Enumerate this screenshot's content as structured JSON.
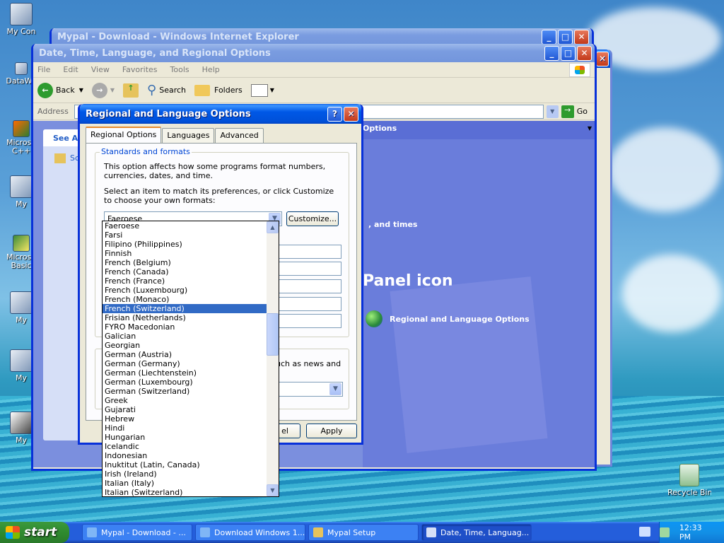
{
  "desktop": {
    "icons": [
      {
        "label": "My Con",
        "name": "my-computer-icon"
      },
      {
        "label": "DataWa",
        "name": "datawa-icon"
      },
      {
        "label": "Microso C++",
        "name": "microsoft-cpp-icon"
      },
      {
        "label": "My",
        "name": "my-doc-icon-1"
      },
      {
        "label": "Microso Basic",
        "name": "microsoft-basic-icon"
      },
      {
        "label": "My",
        "name": "my-doc-icon-2"
      },
      {
        "label": "My",
        "name": "my-doc-icon-3"
      },
      {
        "label": "My",
        "name": "my-doc-icon-4"
      }
    ],
    "recycle_bin": "Recycle Bin"
  },
  "ie_window": {
    "title": "Mypal - Download - Windows Internet Explorer"
  },
  "cp_window": {
    "title": "Date, Time, Language, and Regional Options",
    "menu": [
      "File",
      "Edit",
      "View",
      "Favorites",
      "Tools",
      "Help"
    ],
    "toolbar": {
      "back": "Back",
      "search": "Search",
      "folders": "Folders"
    },
    "address_label": "Address",
    "go": "Go",
    "see_also": "See Als",
    "sched": "Sch",
    "options_link": "Options",
    "times_link": ", and times",
    "panel_icon": "Panel icon",
    "regional_link": "Regional and Language Options"
  },
  "dialog": {
    "title": "Regional and Language Options",
    "tabs": [
      "Regional Options",
      "Languages",
      "Advanced"
    ],
    "group_legend": "Standards and formats",
    "desc1": "This option affects how some programs format numbers, currencies, dates, and time.",
    "desc2": "Select an item to match its preferences, or click Customize to choose your own formats:",
    "selected": "Faeroese",
    "customize": "Customize...",
    "location_text": "uch as news and",
    "cancel_partial": "el",
    "apply": "Apply"
  },
  "dropdown": {
    "items": [
      "Faeroese",
      "Farsi",
      "Filipino (Philippines)",
      "Finnish",
      "French (Belgium)",
      "French (Canada)",
      "French (France)",
      "French (Luxembourg)",
      "French (Monaco)",
      "French (Switzerland)",
      "Frisian (Netherlands)",
      "FYRO Macedonian",
      "Galician",
      "Georgian",
      "German (Austria)",
      "German (Germany)",
      "German (Liechtenstein)",
      "German (Luxembourg)",
      "German (Switzerland)",
      "Greek",
      "Gujarati",
      "Hebrew",
      "Hindi",
      "Hungarian",
      "Icelandic",
      "Indonesian",
      "Inuktitut (Latin, Canada)",
      "Irish (Ireland)",
      "Italian (Italy)",
      "Italian (Switzerland)"
    ],
    "highlighted": "French (Switzerland)"
  },
  "taskbar": {
    "start": "start",
    "tasks": [
      "Mypal - Download - ...",
      "Download Windows 1...",
      "Mypal Setup",
      "Date, Time, Languag..."
    ],
    "active_task": 3,
    "clock": "12:33 PM"
  }
}
